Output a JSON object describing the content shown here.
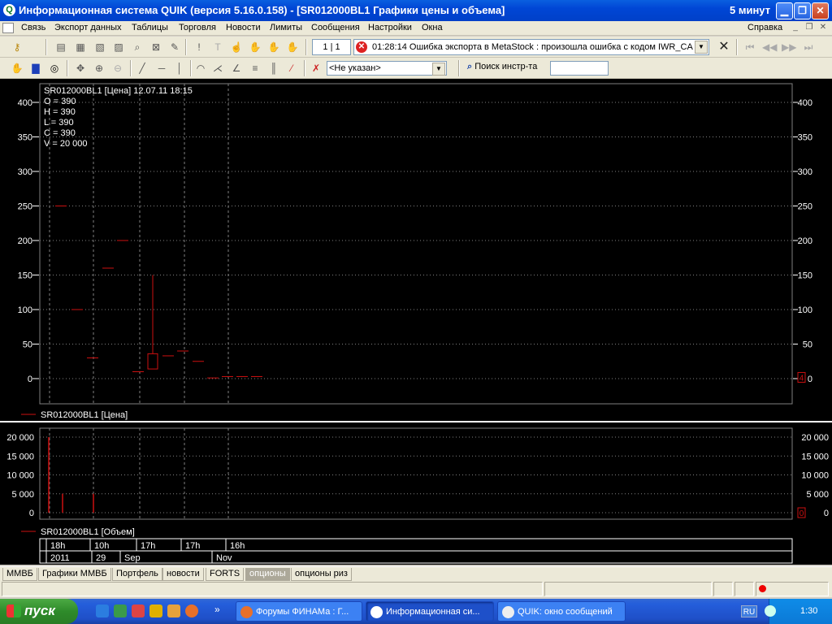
{
  "window": {
    "title": "Информационная система QUIK (версия 5.16.0.158) - [SR012000BL1 Графики цены и объема]",
    "interval": "5 минут",
    "min_icon": "minimize-icon",
    "max_icon": "restore-icon",
    "close_icon": "close-icon"
  },
  "menu": {
    "items": [
      "Связь",
      "Экспорт данных",
      "Таблицы",
      "Торговля",
      "Новости",
      "Лимиты",
      "Сообщения",
      "Настройки",
      "Окна"
    ],
    "help": "Справка"
  },
  "toolbar1": {
    "counter": "1 | 1",
    "error_time": "01:28:14",
    "error_text": "Ошибка экспорта в MetaStock : произошла ошибка с кодом IWR_CA"
  },
  "toolbar2": {
    "security_select": "<Не указан>",
    "search_label": "Поиск инстр-та",
    "search_value": ""
  },
  "chart_data": [
    {
      "type": "candlestick",
      "title": "SR012000BL1 [Цена] 12.07.11 18:15",
      "ohlcv": {
        "O": "O = 390",
        "H": "H = 390",
        "L": "L = 390",
        "C": "C = 390",
        "V": "V = 20 000"
      },
      "legend": "SR012000BL1 [Цена]",
      "ylim": [
        0,
        420
      ],
      "yticks": [
        "0",
        "50",
        "100",
        "150",
        "200",
        "250",
        "300",
        "350",
        "400"
      ],
      "last_marker": "4",
      "candles": [
        {
          "o": 250,
          "h": 250,
          "l": 250,
          "c": 250
        },
        {
          "o": 100,
          "h": 100,
          "l": 100,
          "c": 100
        },
        {
          "o": 30,
          "h": 30,
          "l": 30,
          "c": 30
        },
        {
          "o": 160,
          "h": 160,
          "l": 160,
          "c": 160
        },
        {
          "o": 200,
          "h": 200,
          "l": 200,
          "c": 200
        },
        {
          "o": 10,
          "h": 10,
          "l": 10,
          "c": 10
        },
        {
          "o": 14,
          "h": 150,
          "l": 14,
          "c": 36
        },
        {
          "o": 33,
          "h": 33,
          "l": 33,
          "c": 33
        },
        {
          "o": 40,
          "h": 40,
          "l": 40,
          "c": 40
        },
        {
          "o": 25,
          "h": 25,
          "l": 25,
          "c": 25
        },
        {
          "o": 1,
          "h": 1,
          "l": 1,
          "c": 1
        },
        {
          "o": 3,
          "h": 3,
          "l": 3,
          "c": 3
        },
        {
          "o": 3,
          "h": 3,
          "l": 3,
          "c": 3
        },
        {
          "o": 3,
          "h": 3,
          "l": 3,
          "c": 3
        }
      ],
      "color": "#cc1010"
    },
    {
      "type": "bar",
      "legend": "SR012000BL1 [Объем]",
      "ylim": [
        0,
        21000
      ],
      "yticks": [
        "0",
        "5 000",
        "10 000",
        "15 000",
        "20 000"
      ],
      "last_marker": "0",
      "values": [
        20000,
        5000,
        5000
      ],
      "color": "#cc1010"
    }
  ],
  "time_axis": {
    "row1": [
      "18h",
      "10h",
      "17h",
      "17h",
      "16h"
    ],
    "row2": [
      "2011",
      "29",
      "Sep",
      "Nov"
    ]
  },
  "tabs": [
    "ММВБ",
    "Графики ММВБ",
    "Портфель",
    "новости",
    "FORTS",
    "опционы",
    "опционы риз"
  ],
  "active_tab": "опционы",
  "taskbar": {
    "start": "пуск",
    "tasks": [
      "Форумы ФИНАМа : Г...",
      "Информационная си...",
      "QUIK: окно сообщений"
    ],
    "lang": "RU",
    "clock": "1:30"
  }
}
